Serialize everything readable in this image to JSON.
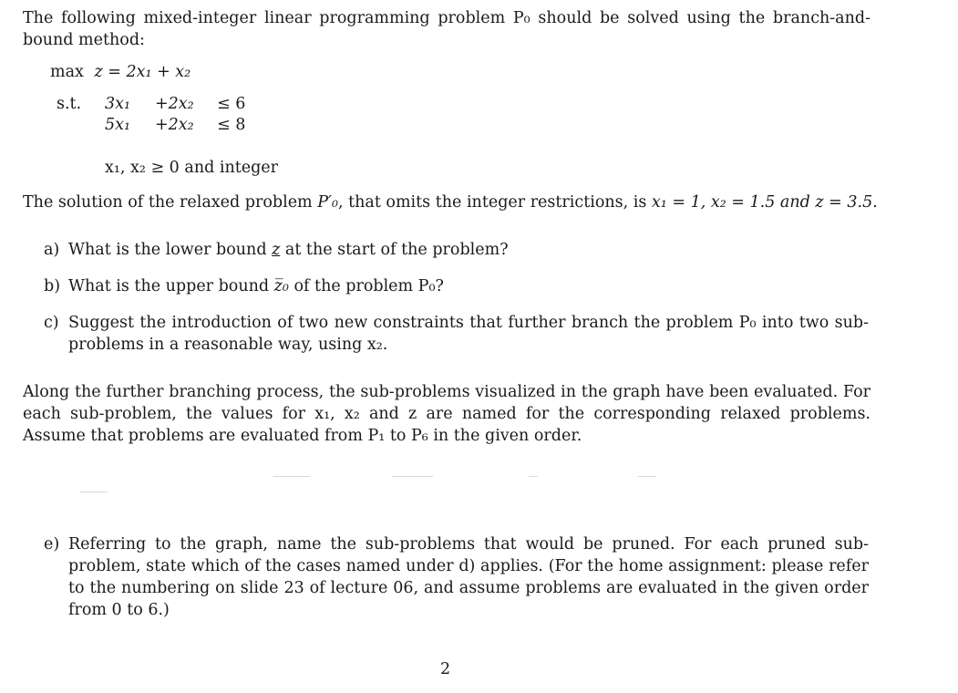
{
  "intro": {
    "text": "The following mixed-integer linear programming problem P₀ should be solved using the branch-and-bound method:"
  },
  "lp": {
    "objective_keyword": "max",
    "objective": "z = 2x₁ + x₂",
    "st_label": "s.t.",
    "constraints": [
      {
        "a": "3x₁",
        "b": "+2x₂",
        "rel": "≤ 6"
      },
      {
        "a": "5x₁",
        "b": "+2x₂",
        "rel": "≤ 8"
      }
    ],
    "domain": "x₁, x₂ ≥ 0 and integer"
  },
  "relaxed": {
    "text_before": "The solution of the relaxed problem ",
    "problem": "P′₀",
    "text_mid": ", that omits the integer restrictions, is ",
    "solution": "x₁ = 1, x₂ = 1.5 and z = 3.5."
  },
  "questions": [
    {
      "label": "a)",
      "text_before": "What is the lower bound ",
      "sym": "z",
      "text_after": " at the start of the problem?"
    },
    {
      "label": "b)",
      "text_before": "What is the upper bound ",
      "sym": "z̅₀",
      "text_after": " of the problem P₀?"
    },
    {
      "label": "c)",
      "text": "Suggest the introduction of two new constraints that further branch the problem P₀ into two sub-problems in a reasonable way, using x₂."
    }
  ],
  "branching": {
    "text": "Along the further branching process, the sub-problems visualized in the graph have been evaluated. For each sub-problem, the values for x₁, x₂ and z are named for the corresponding relaxed problems. Assume that problems are evaluated from P₁ to P₆ in the given order."
  },
  "question_e": {
    "label": "e)",
    "text": "Referring to the graph, name the sub-problems that would be pruned. For each pruned sub-problem, state which of the cases named under d) applies. (For the home assignment: please refer to the numbering on slide 23 of lecture 06, and assume problems are evaluated in the given order from 0 to 6.)"
  },
  "page_number": "2"
}
